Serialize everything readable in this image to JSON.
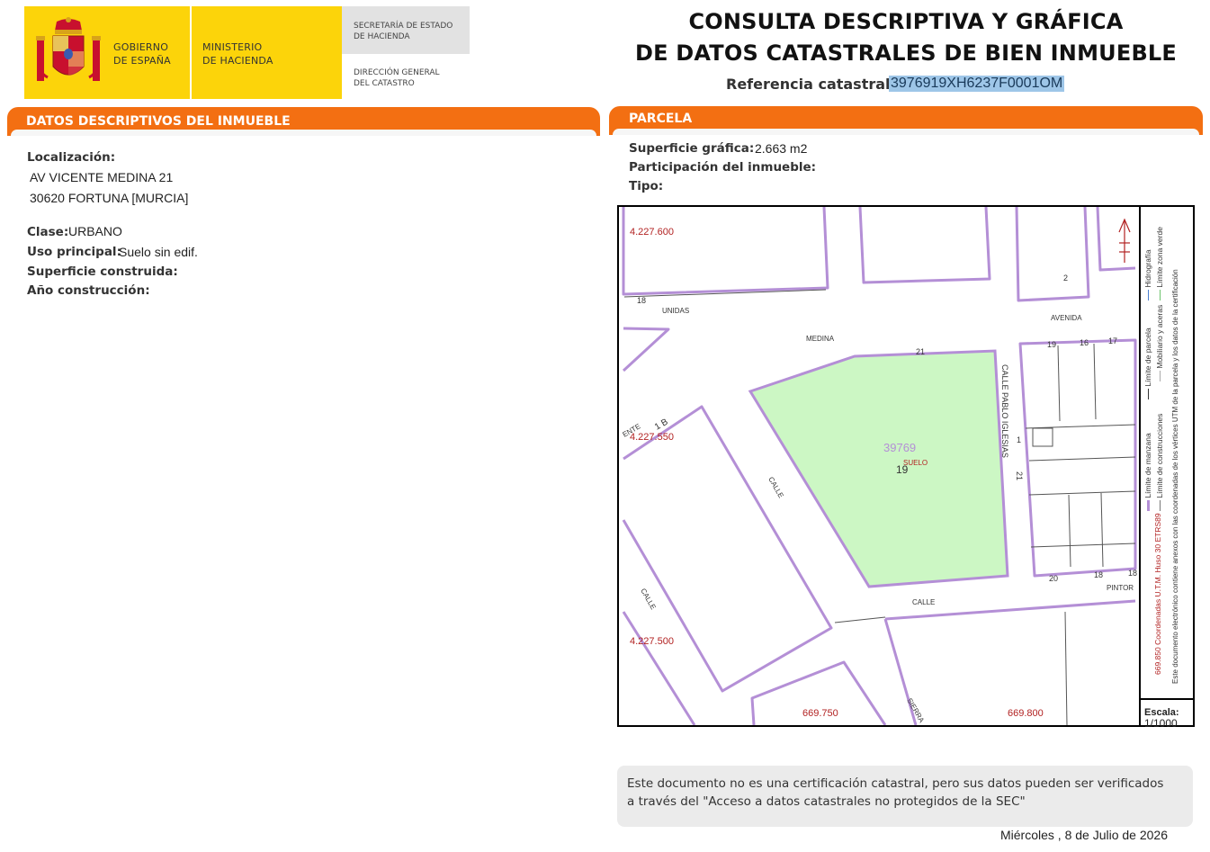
{
  "header": {
    "logo": {
      "gobierno_line1": "GOBIERNO",
      "gobierno_line2": "DE ESPAÑA",
      "ministerio_line1": "MINISTERIO",
      "ministerio_line2": "DE HACIENDA",
      "secretaria_line1": "SECRETARÍA DE ESTADO",
      "secretaria_line2": "DE HACIENDA",
      "direccion_line1": "DIRECCIÓN GENERAL",
      "direccion_line2": "DEL CATASTRO"
    },
    "title_line1": "CONSULTA DESCRIPTIVA Y GRÁFICA",
    "title_line2": "DE DATOS CATASTRALES DE BIEN INMUEBLE",
    "reference_label": "Referencia catastral:",
    "reference_value": "3976919XH6237F0001OM"
  },
  "descriptive": {
    "section_title": "DATOS DESCRIPTIVOS DEL INMUEBLE",
    "localizacion_label": "Localización:",
    "address_line1": "AV VICENTE MEDINA 21",
    "address_line2": "30620 FORTUNA [MURCIA]",
    "clase_label": "Clase:",
    "clase_value": "URBANO",
    "uso_label": "Uso principal:",
    "uso_value": "Suelo sin edif.",
    "superficie_label": "Superficie construida:",
    "ano_label": "Año construcción:"
  },
  "parcela": {
    "section_title": "PARCELA",
    "superficie_label": "Superficie gráfica:",
    "superficie_value": "2.663 m2",
    "participacion_label": "Participación del inmueble:",
    "tipo_label": "Tipo:"
  },
  "map": {
    "parcel_number": "39769",
    "parcel_sub": "19",
    "parcel_tag": "SUELO",
    "coord_y_top": "4.227.600",
    "coord_y_mid": "4.227.550",
    "coord_y_bottom": "4.227.500",
    "coord_x_left": "669.750",
    "coord_x_right": "669.800",
    "street_labels": {
      "unidas": "UNIDAS",
      "avenida": "AVENIDA",
      "medina": "MEDINA",
      "calle_pablo_iglesias": "CALLE PABLO IGLESIAS",
      "calle_mid": "CALLE",
      "calle_left": "CALLE",
      "calle_bottom": "CALLE",
      "pintor": "PINTOR",
      "sierra": "SIERRA",
      "ente": "ENTE"
    },
    "numbers": {
      "n18_left": "18",
      "n2": "2",
      "n21_top": "21",
      "n19": "19",
      "n16": "16",
      "n17": "17",
      "n1": "1",
      "n21_right": "21",
      "n20": "20",
      "n18_bottom": "18",
      "n18_edge": "18",
      "n1b": "1 B"
    },
    "legend": {
      "limite_manzana": "Límite de manzana",
      "limite_parcela": "Límite de parcela",
      "hidrografia": "Hidrografía",
      "limite_construcciones": "Límite de construcciones",
      "mobiliario": "Mobiliario y aceras",
      "zona_verde": "Límite zona verde",
      "coordenadas_prefix": "669.850",
      "coordenadas_text": "Coordenadas U.T.M. Huso 30 ETRS89",
      "documento": "Este documento electrónico contiene anexos con las coordenadas de los vértices UTM de la parcela y los datos de la certificación"
    },
    "scale_label": "Escala:",
    "scale_value": "1/1000",
    "colors": {
      "parcel_fill": "#ccf7c4",
      "manzana_line": "#b48fd6",
      "coord_red": "#b22222"
    }
  },
  "footer": {
    "note": "Este documento no es una certificación catastral, pero sus datos pueden ser verificados a través del \"Acceso a datos catastrales no protegidos de la SEC\"",
    "date": "Miércoles , 8 de Julio de 2026"
  }
}
